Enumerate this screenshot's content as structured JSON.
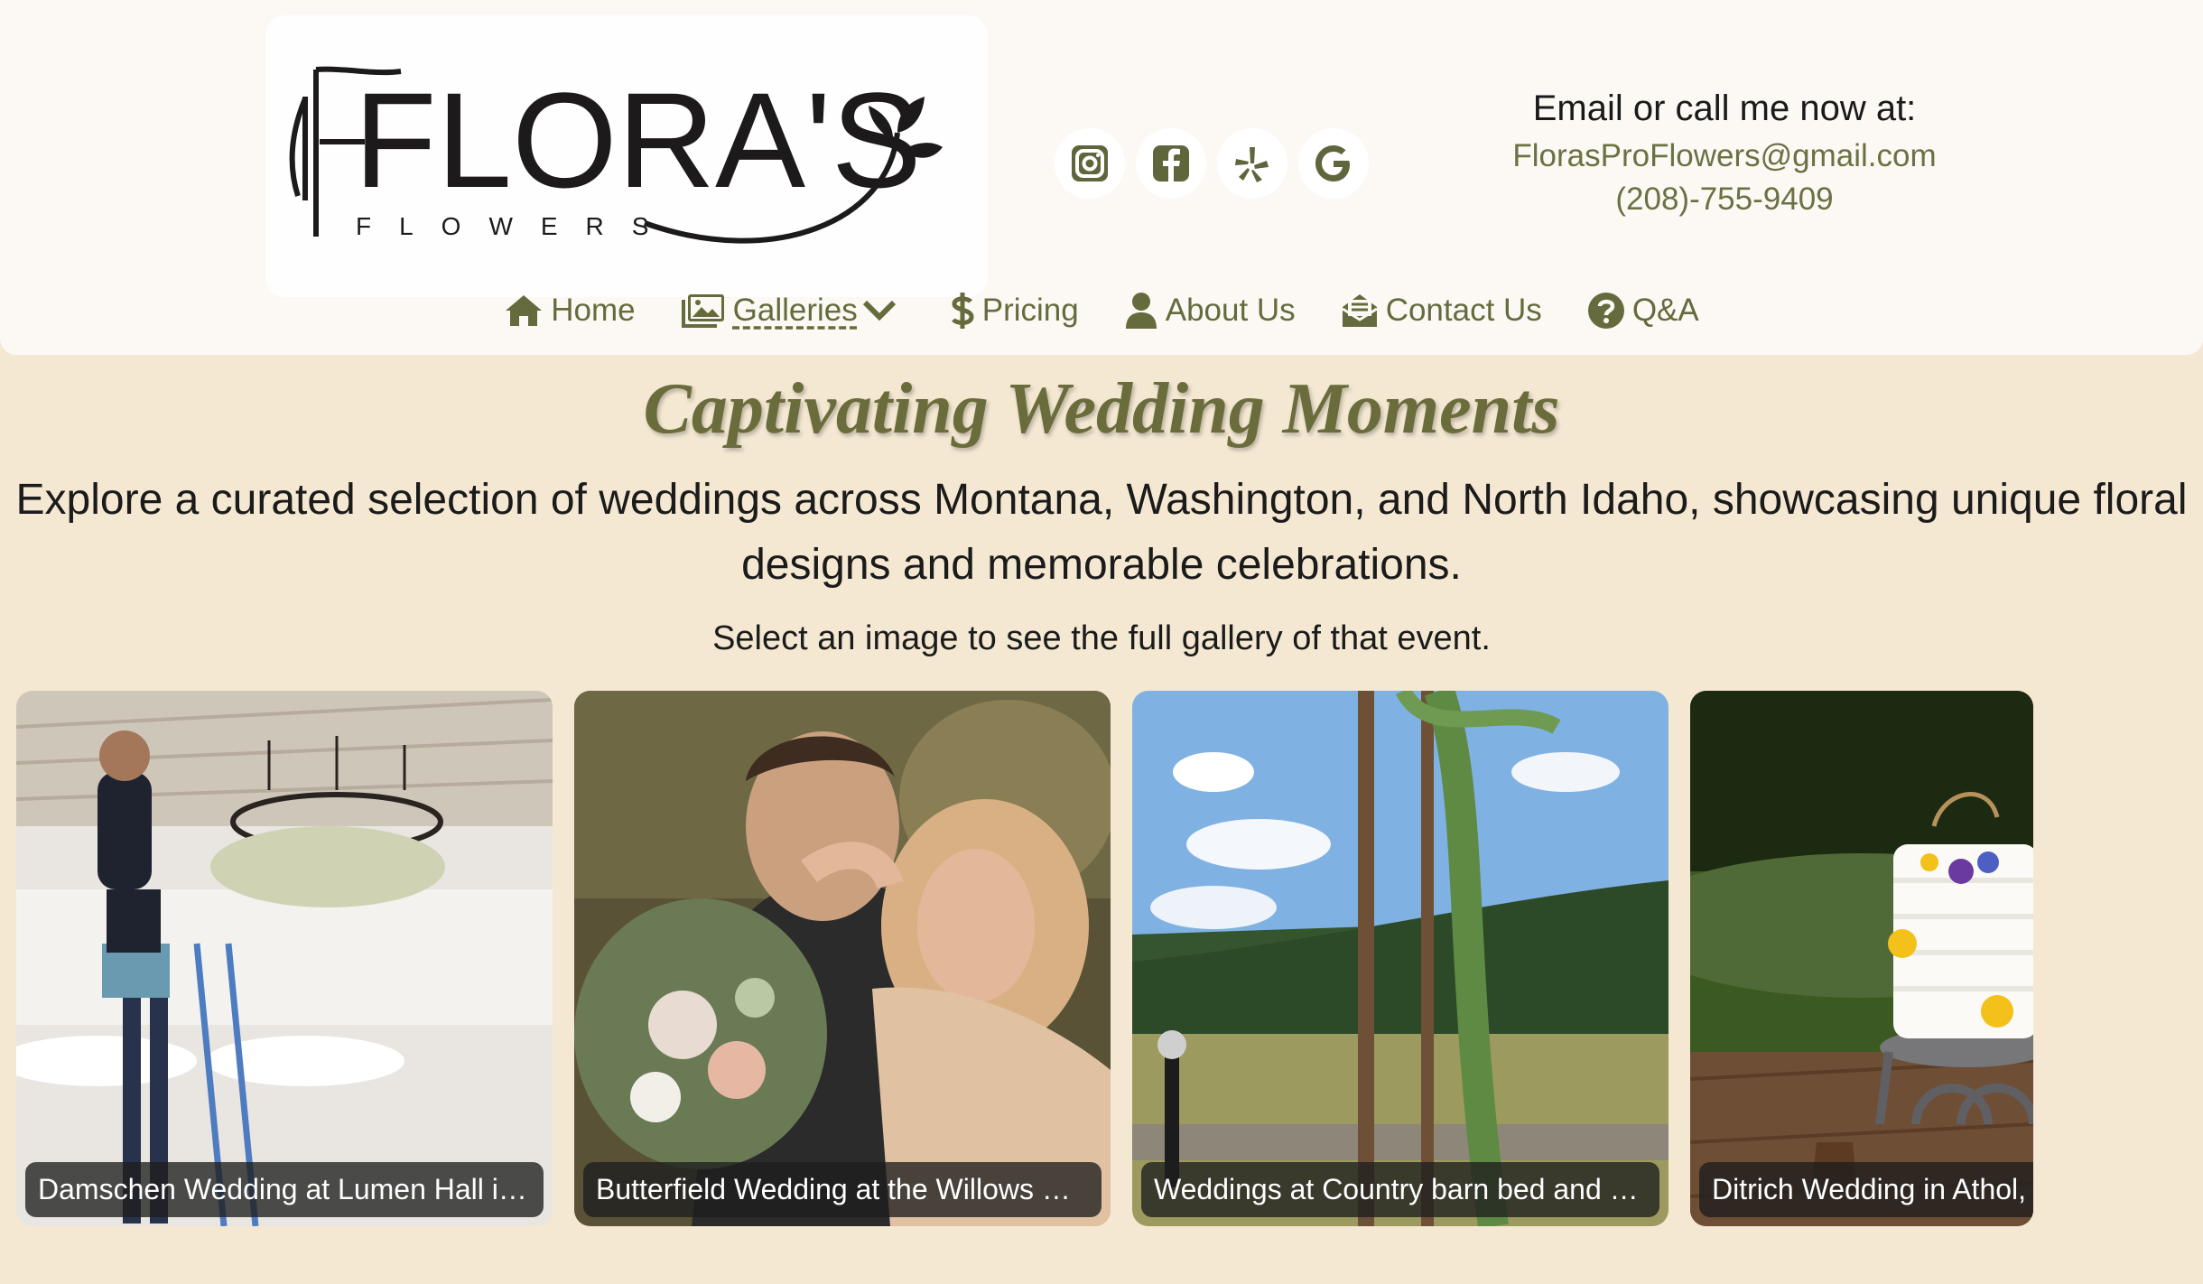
{
  "brand": {
    "logo_text": "FLORA'S",
    "logo_sub": "FLOWERS",
    "accent_color": "#6a6c3c"
  },
  "socials": [
    {
      "icon": "instagram-icon"
    },
    {
      "icon": "facebook-icon"
    },
    {
      "icon": "yelp-icon"
    },
    {
      "icon": "google-icon"
    }
  ],
  "contact": {
    "lead": "Email or call me now at:",
    "email": "FlorasProFlowers@gmail.com",
    "phone": "(208)-755-9409"
  },
  "nav": {
    "home": "Home",
    "galleries": "Galleries",
    "pricing": "Pricing",
    "about": "About Us",
    "contact": "Contact Us",
    "qa": "Q&A"
  },
  "page": {
    "title": "Captivating Wedding Moments",
    "subtitle": "Explore a curated selection of weddings across Montana, Washington, and North Idaho, showcasing unique floral designs and memorable celebrations.",
    "hint": "Select an image to see the full gallery of that event."
  },
  "gallery": [
    {
      "caption": "Damschen Wedding at Lumen Hall in Spokane, WA"
    },
    {
      "caption": "Butterfield Wedding at the Willows Cabin, MT"
    },
    {
      "caption": "Weddings at Country barn bed and breakfast"
    },
    {
      "caption": "Ditrich Wedding in Athol, ID"
    }
  ]
}
